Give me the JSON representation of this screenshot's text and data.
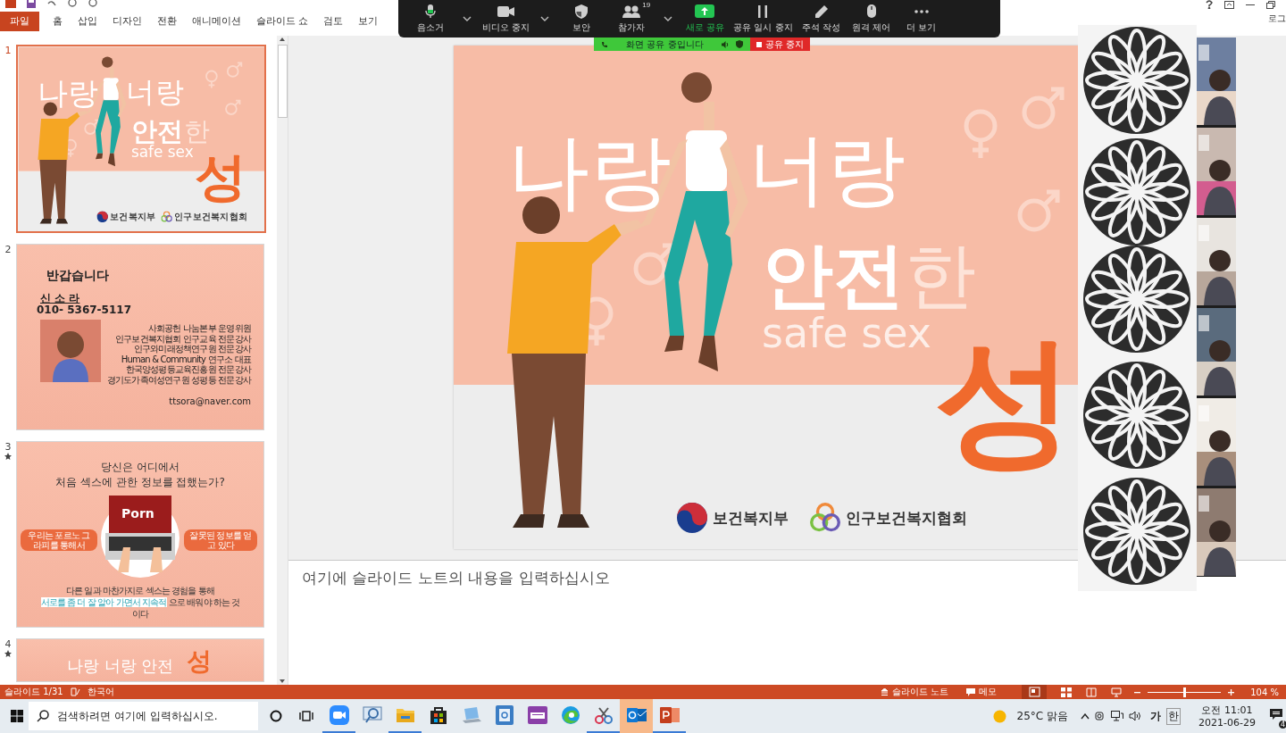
{
  "ribbon_tabs": [
    {
      "label": "파일",
      "selected": true
    },
    {
      "label": "홈",
      "selected": false
    },
    {
      "label": "삽입",
      "selected": false
    },
    {
      "label": "디자인",
      "selected": false
    },
    {
      "label": "전환",
      "selected": false
    },
    {
      "label": "애니메이션",
      "selected": false
    },
    {
      "label": "슬라이드 쇼",
      "selected": false
    },
    {
      "label": "검토",
      "selected": false
    },
    {
      "label": "보기",
      "selected": false
    }
  ],
  "account_label": "로그",
  "zoom_toolbar": [
    {
      "kind": "mic",
      "label": "음소거",
      "menu": true
    },
    {
      "kind": "video",
      "label": "비디오 중지",
      "menu": true
    },
    {
      "kind": "shield",
      "label": "보안",
      "menu": false
    },
    {
      "kind": "people",
      "label": "참가자",
      "count": "19",
      "menu": true
    },
    {
      "kind": "share",
      "label": "새로 공유",
      "menu": false
    },
    {
      "kind": "pause",
      "label": "공유 일시 중지",
      "menu": false
    },
    {
      "kind": "pen",
      "label": "주석 작성",
      "menu": false
    },
    {
      "kind": "mouse",
      "label": "원격 제어",
      "menu": false
    },
    {
      "kind": "more",
      "label": "더 보기",
      "menu": false
    }
  ],
  "share_banner": {
    "status": "화면 공유 중입니다",
    "stop": "공유 중지"
  },
  "slides": [
    {
      "number": "1",
      "kind": "title",
      "selected": true,
      "animated": false
    },
    {
      "number": "2",
      "kind": "intro",
      "selected": false,
      "animated": false
    },
    {
      "number": "3",
      "kind": "question",
      "selected": false,
      "animated": true
    },
    {
      "number": "4",
      "kind": "partial",
      "selected": false,
      "animated": true
    }
  ],
  "title_thumbnail": {
    "line_1": "나랑",
    "line_2": "너랑",
    "line_3_bold": "안전",
    "line_3_light": "한",
    "subtitle": "safe sex",
    "big_word": "성",
    "logos": [
      "보건복지부",
      "인구보건복지협회"
    ]
  },
  "main_slide": {
    "line_1": "나랑",
    "line_2": "너랑",
    "line_3_bold": "안전",
    "line_3_light": "한",
    "subtitle": "safe sex",
    "big_word": "성",
    "logos": [
      "보건복지부",
      "인구보건복지협회"
    ]
  },
  "intro_slide": {
    "heading": "반갑습니다",
    "name": "신 소 라",
    "phone": "010- 5367-5117",
    "bio": [
      "사회공헌 나눔본부 운영위원",
      "인구보건복지협회 인구교육 전문강사",
      "인구와미래정책연구원 전문강사",
      "Human & Community 연구소 대표",
      "한국양성평등교육진흥원 전문강사",
      "경기도가족여성연구원 성평등 전문강사"
    ],
    "email": "ttsora@naver.com"
  },
  "question_slide": {
    "question": [
      "당신은 어디에서",
      "처음 섹스에 관한 정보를 접했는가?"
    ],
    "screen_text": "Porn",
    "left_pill": "우리는 포르노 그라피를 통해서",
    "right_pill": "잘못된 정보를 얻고 있다",
    "closing_1": "다른 일과 마찬가지로 섹스는 경험을 통해",
    "closing_highlight": "서로를 좀 더 잘 알아 가면서 지속적",
    "closing_2": " 으로 배워야 하는 것",
    "closing_3": "이다"
  },
  "partial_slide": {
    "title": "나랑 너랑 안전",
    "big_word": "성"
  },
  "notes": {
    "placeholder": "여기에 슬라이드 노트의 내용을 입력하십시오"
  },
  "status_bar": {
    "slide_counter": "슬라이드 1/31",
    "language": "한국어",
    "notes_button": "슬라이드 노트",
    "comments_button": "메모",
    "zoom_level": "104 %",
    "zoom": {
      "level": 0.5
    }
  },
  "taskbar": {
    "search_placeholder": "검색하려면 여기에 입력하십시오.",
    "apps": [
      {
        "kind": "zoom",
        "running": true,
        "highlighted": false
      },
      {
        "kind": "magnifier",
        "running": false,
        "highlighted": false
      },
      {
        "kind": "folder",
        "running": true,
        "highlighted": false
      },
      {
        "kind": "store",
        "running": false,
        "highlighted": false
      },
      {
        "kind": "laptop",
        "running": false,
        "highlighted": false
      },
      {
        "kind": "hwp",
        "running": false,
        "highlighted": false
      },
      {
        "kind": "keyboard",
        "running": false,
        "highlighted": false
      },
      {
        "kind": "edge",
        "running": false,
        "highlighted": false
      },
      {
        "kind": "snip",
        "running": true,
        "highlighted": false
      },
      {
        "kind": "mail",
        "running": false,
        "highlighted": true
      },
      {
        "kind": "slides",
        "running": true,
        "highlighted": false
      }
    ],
    "weather": "25°C 맑음",
    "ime_mode": "가",
    "ime_lang": "한",
    "time": "오전 11:01",
    "date": "2021-06-29",
    "notifications": "4"
  }
}
